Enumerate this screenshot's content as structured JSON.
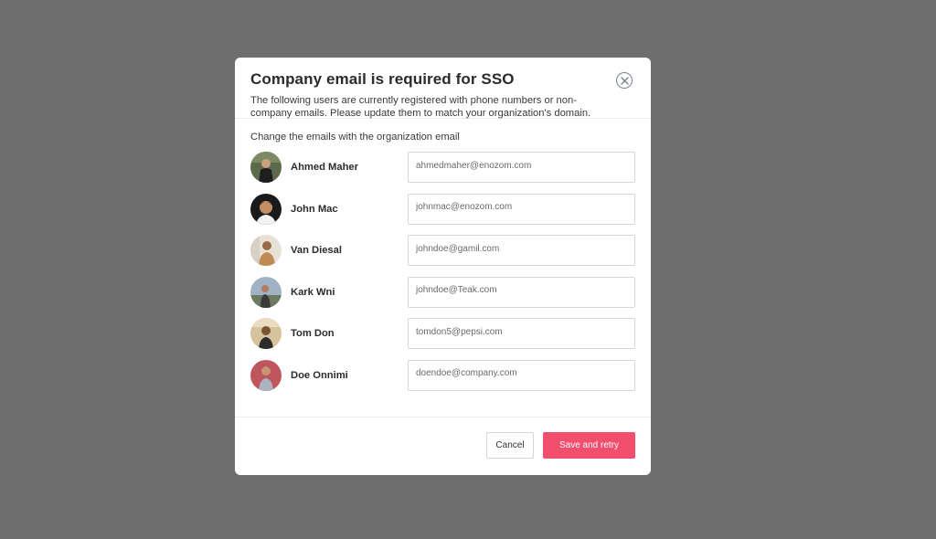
{
  "modal": {
    "title": "Company email is required for SSO",
    "description": "The following users are currently registered with phone numbers or non-company emails. Please update them to match your organization's domain.",
    "instruction": "Change the emails with the organization email",
    "close_icon": "close-circle-icon"
  },
  "users": [
    {
      "name": "Ahmed Maher",
      "email": "ahmedmaher@enozom.com"
    },
    {
      "name": "John Mac",
      "email": "johnmac@enozom.com"
    },
    {
      "name": "Van Diesal",
      "email": "johndoe@gamil.com"
    },
    {
      "name": "Kark Wni",
      "email": "johndoe@Teak.com"
    },
    {
      "name": "Tom Don",
      "email": "tomdon5@pepsi.com"
    },
    {
      "name": "Doe Onnimi",
      "email": "doendoe@company.com"
    }
  ],
  "footer": {
    "cancel_label": "Cancel",
    "save_label": "Save and retry"
  },
  "colors": {
    "overlay": "#6e6e6e",
    "primary": "#f24e6d",
    "text": "#2b2b2b"
  }
}
